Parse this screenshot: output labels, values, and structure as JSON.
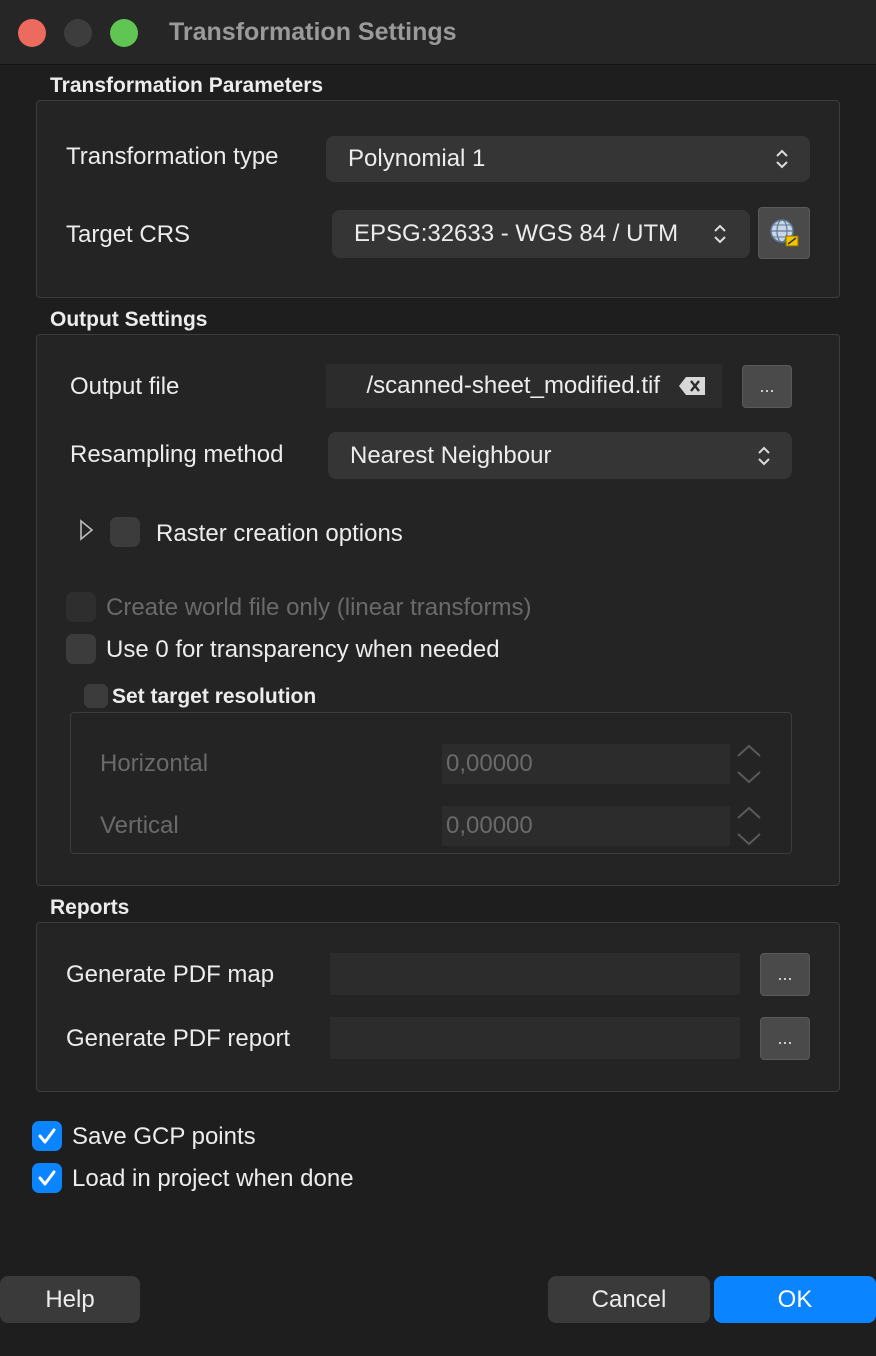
{
  "window": {
    "title": "Transformation Settings"
  },
  "transformation_parameters": {
    "title": "Transformation Parameters",
    "transformation_type_label": "Transformation type",
    "transformation_type_value": "Polynomial 1",
    "target_crs_label": "Target CRS",
    "target_crs_value": "EPSG:32633 - WGS 84 / UTM"
  },
  "output_settings": {
    "title": "Output Settings",
    "output_file_label": "Output file",
    "output_file_value": "/scanned-sheet_modified.tif",
    "browse_label": "...",
    "resampling_label": "Resampling method",
    "resampling_value": "Nearest Neighbour",
    "raster_options_label": "Raster creation options",
    "world_file_label": "Create world file only (linear transforms)",
    "transparency_label": "Use 0 for transparency when needed",
    "target_resolution_label": "Set target resolution",
    "horizontal_label": "Horizontal",
    "horizontal_value": "0,00000",
    "vertical_label": "Vertical",
    "vertical_value": "0,00000"
  },
  "reports": {
    "title": "Reports",
    "pdf_map_label": "Generate PDF map",
    "pdf_report_label": "Generate PDF report",
    "browse_label": "..."
  },
  "options": {
    "save_gcp_label": "Save GCP points",
    "save_gcp_checked": true,
    "load_project_label": "Load in project when done",
    "load_project_checked": true
  },
  "buttons": {
    "help": "Help",
    "cancel": "Cancel",
    "ok": "OK"
  },
  "colors": {
    "accent": "#0a84ff",
    "close": "#ed6a5e",
    "minimize": "#3d3d3d",
    "zoom": "#61c554"
  }
}
